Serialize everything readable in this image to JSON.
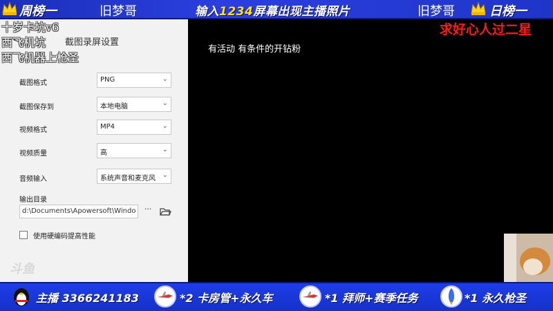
{
  "top_banner": {
    "left_rank": "周榜一",
    "left_name": "旧梦哥",
    "center_prefix": "输入",
    "center_code": "1234",
    "center_suffix": "屏幕出现主播照片",
    "right_name": "旧梦哥",
    "right_rank": "日榜一"
  },
  "right_overlay": "求好心人过二星",
  "overlay_scribbles": [
    "十岁卡坑v6",
    "西飞机坑"
  ],
  "overlay_scribble_3": "西飞机器上枪圣",
  "panel": {
    "back_icon": "back-arrow-icon",
    "title": "截图录屏设置",
    "rows": [
      {
        "label": "截图格式",
        "value": "PNG"
      },
      {
        "label": "截图保存到",
        "value": "本地电脑"
      },
      {
        "label": "视频格式",
        "value": "MP4"
      },
      {
        "label": "视频质量",
        "value": "高"
      },
      {
        "label": "音频输入",
        "value": "系统声音和麦克风"
      }
    ],
    "output_label": "输出目录",
    "output_path": "d:\\Documents\\Apowersoft\\Windo",
    "more_label": "···",
    "checkbox_label": "使用硬编码提高性能",
    "watermark": "斗鱼"
  },
  "main_text": "有活动 有条件的开钻粉",
  "bottom_bar": {
    "items": [
      "主播 3366241183",
      "*2 卡房管+永久车",
      "*1 拜师+赛季任务",
      "*1 永久枪圣"
    ]
  },
  "colors": {
    "banner_blue": "#2b3fe0",
    "highlight_yellow": "#ffdf2a",
    "overlay_red": "#ff1a1a"
  }
}
